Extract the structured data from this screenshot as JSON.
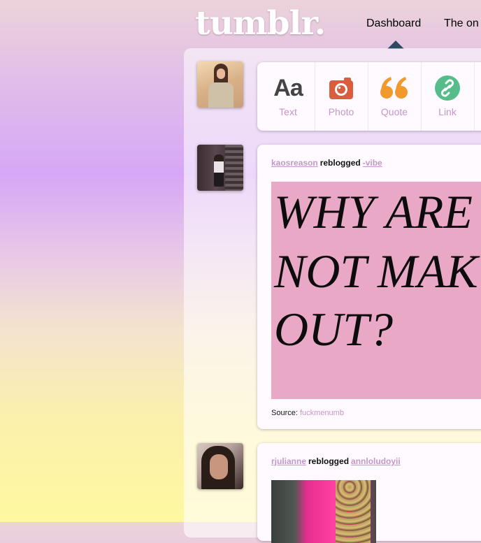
{
  "header": {
    "logo": "tumblr.",
    "nav": [
      {
        "label": "Dashboard",
        "active": true
      },
      {
        "label": "The on"
      }
    ]
  },
  "post_types": [
    {
      "label": "Text",
      "icon": "text-icon",
      "color": "#444444",
      "glyph": "Aa"
    },
    {
      "label": "Photo",
      "icon": "camera-icon",
      "color": "#d95e40"
    },
    {
      "label": "Quote",
      "icon": "quote-icon",
      "color": "#f2992e"
    },
    {
      "label": "Link",
      "icon": "link-icon",
      "color": "#56bc8a"
    }
  ],
  "posts": [
    {
      "reblogger": "kaosreason",
      "verb": "reblogged",
      "original": "-vibe",
      "image_text": [
        "WHY ARE",
        "NOT MAK",
        "OUT?"
      ],
      "image_background": "#e9a8c6",
      "source_label": "Source:",
      "source_link": "fuckmenumb"
    },
    {
      "reblogger": "rjulianne",
      "verb": "reblogged",
      "original": "annloludoyii"
    }
  ],
  "colors": {
    "link": "#c695c9",
    "nav_caret": "#2f4863"
  }
}
